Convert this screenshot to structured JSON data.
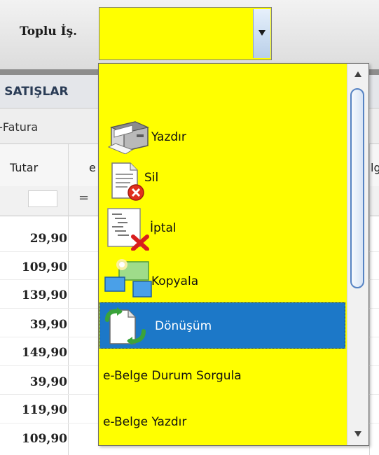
{
  "toolbar": {
    "label": "Toplu İş."
  },
  "grid": {
    "title": "I SATIŞLAR",
    "tab": "E-Fatura",
    "columns": {
      "tutar": "Tutar",
      "second": "e",
      "third": "lg"
    },
    "filter_operator": "=",
    "tutar_values": [
      "29,90",
      "109,90",
      "139,90",
      "39,90",
      "149,90",
      "39,90",
      "119,90",
      "109,90"
    ]
  },
  "combo": {
    "value": "",
    "icon": "chevron-down-icon"
  },
  "dropdown": {
    "items": [
      {
        "label": "Yazdır",
        "icon": "printer-icon"
      },
      {
        "label": "Sil",
        "icon": "delete-document-icon"
      },
      {
        "label": "İptal",
        "icon": "cancel-list-icon"
      },
      {
        "label": "Kopyala",
        "icon": "copy-icon"
      },
      {
        "label": "Dönüşüm",
        "icon": "convert-icon",
        "selected": true
      },
      {
        "label": "e-Belge Durum Sorgula"
      },
      {
        "label": "e-Belge Yazdır"
      }
    ]
  },
  "colors": {
    "combo_bg": "#ffff00",
    "selection": "#1c78c8",
    "scroll_thumb_border": "#5683c3"
  }
}
